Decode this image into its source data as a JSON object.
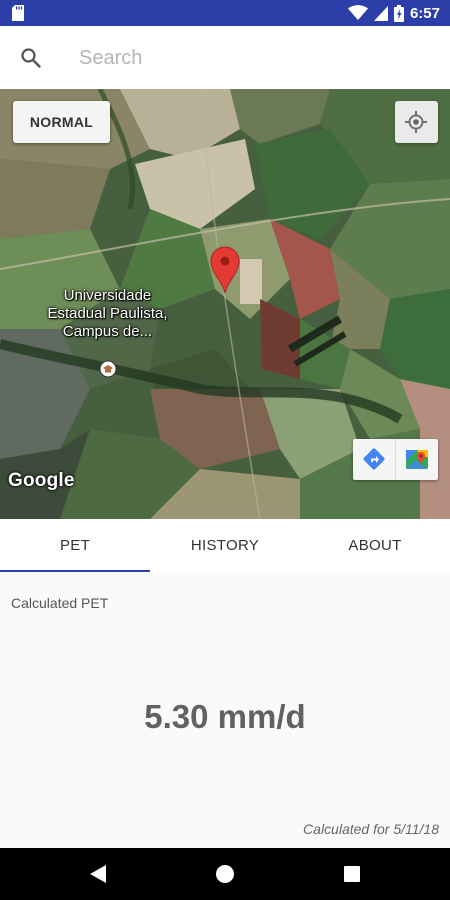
{
  "status_bar": {
    "time": "6:57",
    "icons": [
      "sd-card-icon",
      "wifi-icon",
      "cell-signal-icon",
      "battery-icon"
    ]
  },
  "search": {
    "placeholder": "Search",
    "value": "",
    "icon": "search-icon"
  },
  "map": {
    "type_button_label": "NORMAL",
    "poi_label": "Universidade Estadual Paulista, Campus de...",
    "attribution": "Google",
    "controls": [
      "my-location-icon",
      "directions-icon",
      "google-maps-icon"
    ],
    "marker": "location-pin-icon",
    "colors": {
      "marker_red": "#e53935",
      "directions_blue": "#4285f4"
    }
  },
  "tabs": [
    {
      "label": "PET",
      "active": true
    },
    {
      "label": "HISTORY",
      "active": false
    },
    {
      "label": "ABOUT",
      "active": false
    }
  ],
  "pet": {
    "label": "Calculated PET",
    "value": "5.30 mm/d",
    "date_text": "Calculated for 5/11/18"
  },
  "nav_bar": {
    "buttons": [
      "back-icon",
      "home-icon",
      "recents-icon"
    ]
  },
  "colors": {
    "primary": "#2c3fa8",
    "tab_indicator": "#2c3fa8",
    "value_text": "#616161"
  }
}
